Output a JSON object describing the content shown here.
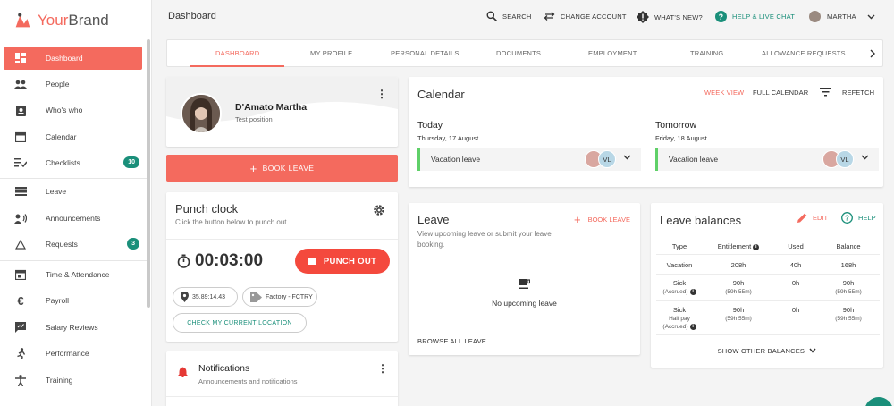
{
  "brand": {
    "name_a": "Your",
    "name_b": "Brand"
  },
  "header": {
    "title": "Dashboard",
    "search": "SEARCH",
    "change_account": "CHANGE ACCOUNT",
    "whats_new": "WHAT'S NEW?",
    "help": "HELP & LIVE CHAT",
    "user": "MARTHA"
  },
  "sidebar": {
    "items": [
      {
        "label": "Dashboard",
        "icon": "dashboard-icon"
      },
      {
        "label": "People",
        "icon": "people-icon"
      },
      {
        "label": "Who's who",
        "icon": "badge-icon"
      },
      {
        "label": "Calendar",
        "icon": "calendar-icon"
      },
      {
        "label": "Checklists",
        "icon": "checklist-icon",
        "badge": "10"
      },
      {
        "label": "Leave",
        "icon": "leave-icon"
      },
      {
        "label": "Announcements",
        "icon": "announcement-icon"
      },
      {
        "label": "Requests",
        "icon": "requests-icon",
        "badge": "3"
      },
      {
        "label": "Time & Attendance",
        "icon": "time-icon"
      },
      {
        "label": "Payroll",
        "icon": "euro-icon"
      },
      {
        "label": "Salary Reviews",
        "icon": "review-icon"
      },
      {
        "label": "Performance",
        "icon": "performance-icon"
      },
      {
        "label": "Training",
        "icon": "training-icon"
      }
    ]
  },
  "tabs": [
    "DASHBOARD",
    "MY PROFILE",
    "PERSONAL DETAILS",
    "DOCUMENTS",
    "EMPLOYMENT",
    "TRAINING",
    "ALLOWANCE REQUESTS"
  ],
  "profile": {
    "name": "D'Amato Martha",
    "position": "Test position"
  },
  "book_leave": "BOOK LEAVE",
  "punch": {
    "title": "Punch clock",
    "subtitle": "Click the button below to punch out.",
    "timer": "00:03:00",
    "button": "PUNCH OUT",
    "coords": "35.89:14.43",
    "location": "Factory - FCTRY",
    "check_location": "CHECK MY CURRENT LOCATION"
  },
  "notifications": {
    "title": "Notifications",
    "subtitle": "Announcements and notifications"
  },
  "calendar": {
    "title": "Calendar",
    "week_view": "WEEK VIEW",
    "full": "FULL CALENDAR",
    "refetch": "REFETCH",
    "days": [
      {
        "head": "Today",
        "date": "Thursday, 17 August",
        "entry": "Vacation leave",
        "initials": "VL"
      },
      {
        "head": "Tomorrow",
        "date": "Friday, 18 August",
        "entry": "Vacation leave",
        "initials": "VL"
      }
    ]
  },
  "leave": {
    "title": "Leave",
    "subtitle": "View upcoming leave or submit your leave booking.",
    "book": "BOOK LEAVE",
    "empty": "No upcoming leave",
    "browse": "BROWSE ALL LEAVE"
  },
  "balances": {
    "title": "Leave balances",
    "edit": "EDIT",
    "help": "HELP",
    "headers": [
      "Type",
      "Entitlement",
      "Used",
      "Balance"
    ],
    "rows": [
      {
        "type": "Vacation",
        "type_sub": "",
        "ent": "208h",
        "ent_sub": "",
        "used": "40h",
        "bal": "168h",
        "bal_sub": ""
      },
      {
        "type": "Sick",
        "type_sub": "(Accrued)",
        "ent": "90h",
        "ent_sub": "(59h 55m)",
        "used": "0h",
        "bal": "90h",
        "bal_sub": "(59h 55m)"
      },
      {
        "type": "Sick",
        "type_sub2": "Half pay",
        "type_sub": "(Accrued)",
        "ent": "90h",
        "ent_sub": "(59h 55m)",
        "used": "0h",
        "bal": "90h",
        "bal_sub": "(59h 55m)"
      }
    ],
    "footer": "SHOW OTHER BALANCES"
  },
  "colors": {
    "accent": "#f46a5e",
    "green": "#1a8f7a",
    "punch": "#f4493d",
    "leave_bar": "#5fd068"
  }
}
